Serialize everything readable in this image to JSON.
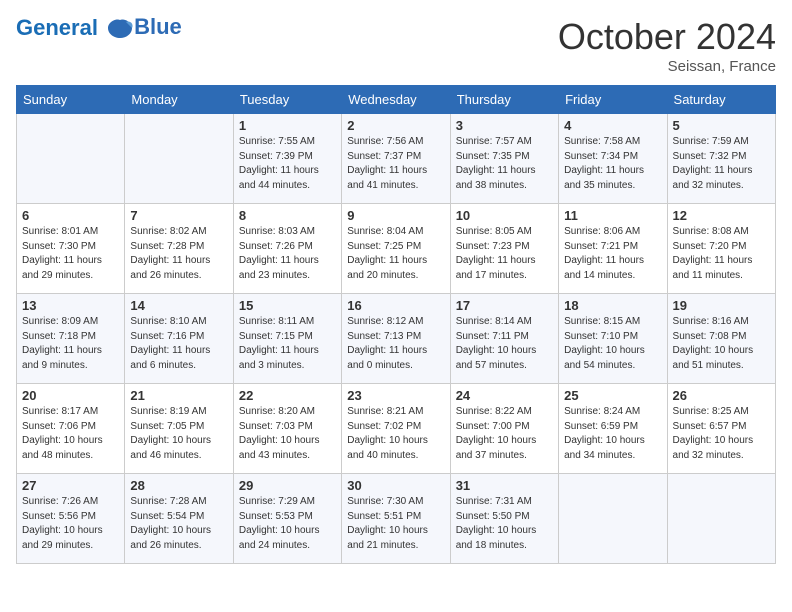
{
  "logo": {
    "line1": "General",
    "line2": "Blue"
  },
  "title": "October 2024",
  "location": "Seissan, France",
  "header_days": [
    "Sunday",
    "Monday",
    "Tuesday",
    "Wednesday",
    "Thursday",
    "Friday",
    "Saturday"
  ],
  "weeks": [
    [
      {
        "day": "",
        "sunrise": "",
        "sunset": "",
        "daylight": ""
      },
      {
        "day": "",
        "sunrise": "",
        "sunset": "",
        "daylight": ""
      },
      {
        "day": "1",
        "sunrise": "Sunrise: 7:55 AM",
        "sunset": "Sunset: 7:39 PM",
        "daylight": "Daylight: 11 hours and 44 minutes."
      },
      {
        "day": "2",
        "sunrise": "Sunrise: 7:56 AM",
        "sunset": "Sunset: 7:37 PM",
        "daylight": "Daylight: 11 hours and 41 minutes."
      },
      {
        "day": "3",
        "sunrise": "Sunrise: 7:57 AM",
        "sunset": "Sunset: 7:35 PM",
        "daylight": "Daylight: 11 hours and 38 minutes."
      },
      {
        "day": "4",
        "sunrise": "Sunrise: 7:58 AM",
        "sunset": "Sunset: 7:34 PM",
        "daylight": "Daylight: 11 hours and 35 minutes."
      },
      {
        "day": "5",
        "sunrise": "Sunrise: 7:59 AM",
        "sunset": "Sunset: 7:32 PM",
        "daylight": "Daylight: 11 hours and 32 minutes."
      }
    ],
    [
      {
        "day": "6",
        "sunrise": "Sunrise: 8:01 AM",
        "sunset": "Sunset: 7:30 PM",
        "daylight": "Daylight: 11 hours and 29 minutes."
      },
      {
        "day": "7",
        "sunrise": "Sunrise: 8:02 AM",
        "sunset": "Sunset: 7:28 PM",
        "daylight": "Daylight: 11 hours and 26 minutes."
      },
      {
        "day": "8",
        "sunrise": "Sunrise: 8:03 AM",
        "sunset": "Sunset: 7:26 PM",
        "daylight": "Daylight: 11 hours and 23 minutes."
      },
      {
        "day": "9",
        "sunrise": "Sunrise: 8:04 AM",
        "sunset": "Sunset: 7:25 PM",
        "daylight": "Daylight: 11 hours and 20 minutes."
      },
      {
        "day": "10",
        "sunrise": "Sunrise: 8:05 AM",
        "sunset": "Sunset: 7:23 PM",
        "daylight": "Daylight: 11 hours and 17 minutes."
      },
      {
        "day": "11",
        "sunrise": "Sunrise: 8:06 AM",
        "sunset": "Sunset: 7:21 PM",
        "daylight": "Daylight: 11 hours and 14 minutes."
      },
      {
        "day": "12",
        "sunrise": "Sunrise: 8:08 AM",
        "sunset": "Sunset: 7:20 PM",
        "daylight": "Daylight: 11 hours and 11 minutes."
      }
    ],
    [
      {
        "day": "13",
        "sunrise": "Sunrise: 8:09 AM",
        "sunset": "Sunset: 7:18 PM",
        "daylight": "Daylight: 11 hours and 9 minutes."
      },
      {
        "day": "14",
        "sunrise": "Sunrise: 8:10 AM",
        "sunset": "Sunset: 7:16 PM",
        "daylight": "Daylight: 11 hours and 6 minutes."
      },
      {
        "day": "15",
        "sunrise": "Sunrise: 8:11 AM",
        "sunset": "Sunset: 7:15 PM",
        "daylight": "Daylight: 11 hours and 3 minutes."
      },
      {
        "day": "16",
        "sunrise": "Sunrise: 8:12 AM",
        "sunset": "Sunset: 7:13 PM",
        "daylight": "Daylight: 11 hours and 0 minutes."
      },
      {
        "day": "17",
        "sunrise": "Sunrise: 8:14 AM",
        "sunset": "Sunset: 7:11 PM",
        "daylight": "Daylight: 10 hours and 57 minutes."
      },
      {
        "day": "18",
        "sunrise": "Sunrise: 8:15 AM",
        "sunset": "Sunset: 7:10 PM",
        "daylight": "Daylight: 10 hours and 54 minutes."
      },
      {
        "day": "19",
        "sunrise": "Sunrise: 8:16 AM",
        "sunset": "Sunset: 7:08 PM",
        "daylight": "Daylight: 10 hours and 51 minutes."
      }
    ],
    [
      {
        "day": "20",
        "sunrise": "Sunrise: 8:17 AM",
        "sunset": "Sunset: 7:06 PM",
        "daylight": "Daylight: 10 hours and 48 minutes."
      },
      {
        "day": "21",
        "sunrise": "Sunrise: 8:19 AM",
        "sunset": "Sunset: 7:05 PM",
        "daylight": "Daylight: 10 hours and 46 minutes."
      },
      {
        "day": "22",
        "sunrise": "Sunrise: 8:20 AM",
        "sunset": "Sunset: 7:03 PM",
        "daylight": "Daylight: 10 hours and 43 minutes."
      },
      {
        "day": "23",
        "sunrise": "Sunrise: 8:21 AM",
        "sunset": "Sunset: 7:02 PM",
        "daylight": "Daylight: 10 hours and 40 minutes."
      },
      {
        "day": "24",
        "sunrise": "Sunrise: 8:22 AM",
        "sunset": "Sunset: 7:00 PM",
        "daylight": "Daylight: 10 hours and 37 minutes."
      },
      {
        "day": "25",
        "sunrise": "Sunrise: 8:24 AM",
        "sunset": "Sunset: 6:59 PM",
        "daylight": "Daylight: 10 hours and 34 minutes."
      },
      {
        "day": "26",
        "sunrise": "Sunrise: 8:25 AM",
        "sunset": "Sunset: 6:57 PM",
        "daylight": "Daylight: 10 hours and 32 minutes."
      }
    ],
    [
      {
        "day": "27",
        "sunrise": "Sunrise: 7:26 AM",
        "sunset": "Sunset: 5:56 PM",
        "daylight": "Daylight: 10 hours and 29 minutes."
      },
      {
        "day": "28",
        "sunrise": "Sunrise: 7:28 AM",
        "sunset": "Sunset: 5:54 PM",
        "daylight": "Daylight: 10 hours and 26 minutes."
      },
      {
        "day": "29",
        "sunrise": "Sunrise: 7:29 AM",
        "sunset": "Sunset: 5:53 PM",
        "daylight": "Daylight: 10 hours and 24 minutes."
      },
      {
        "day": "30",
        "sunrise": "Sunrise: 7:30 AM",
        "sunset": "Sunset: 5:51 PM",
        "daylight": "Daylight: 10 hours and 21 minutes."
      },
      {
        "day": "31",
        "sunrise": "Sunrise: 7:31 AM",
        "sunset": "Sunset: 5:50 PM",
        "daylight": "Daylight: 10 hours and 18 minutes."
      },
      {
        "day": "",
        "sunrise": "",
        "sunset": "",
        "daylight": ""
      },
      {
        "day": "",
        "sunrise": "",
        "sunset": "",
        "daylight": ""
      }
    ]
  ]
}
